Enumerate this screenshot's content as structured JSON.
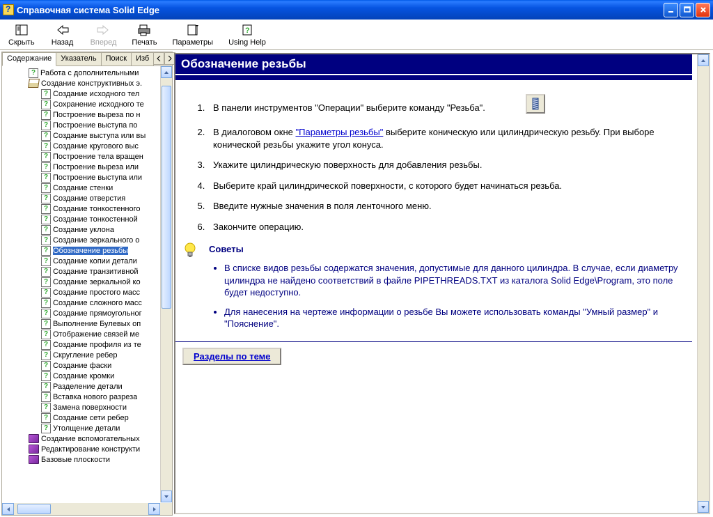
{
  "window": {
    "title": "Справочная система Solid Edge"
  },
  "toolbar": {
    "hide": "Скрыть",
    "back": "Назад",
    "forward": "Вперед",
    "print": "Печать",
    "options": "Параметры",
    "using_help": "Using Help"
  },
  "tabs": {
    "contents": "Содержание",
    "index": "Указатель",
    "search": "Поиск",
    "favorites": "Изб"
  },
  "tree": {
    "root1": "Работа с дополнительными",
    "root2": "Создание конструктивных э.",
    "children2": [
      "Создание исходного тел",
      "Сохранение исходного те",
      "Построение выреза по н",
      "Построение выступа по",
      "Создание выступа или вы",
      "Создание кругового выс",
      "Построение тела вращен",
      "Построение выреза или",
      "Построение выступа или",
      "Создание стенки",
      "Создание отверстия",
      "Создание тонкостенного",
      "Создание тонкостенной",
      "Создание уклона",
      "Создание зеркального о",
      "Обозначение резьбы",
      "Создание копии детали",
      "Создание транзитивной",
      "Создание зеркальной ко",
      "Создание простого масс",
      "Создание сложного масс",
      "Создание прямоугольног",
      "Выполнение Булевых оп",
      "Отображение связей ме",
      "Создание профиля из те",
      "Скругление ребер",
      "Создание фаски",
      "Создание кромки",
      "Разделение детали",
      "Вставка нового разреза",
      "Замена поверхности",
      "Создание сети ребер",
      "Утолщение детали"
    ],
    "root3": "Создание вспомогательных",
    "root4": "Редактирование конструкти",
    "root5": "Базовые плоскости",
    "selected_index": 15
  },
  "content": {
    "title": "Обозначение резьбы",
    "step1": "В панели инструментов \"Операции\" выберите команду \"Резьба\".",
    "step2a": "В диалоговом окне ",
    "step2_link": "\"Параметры резьбы\"",
    "step2b": " выберите коническую или цилиндрическую резьбу. При выборе конической резьбы укажите угол конуса.",
    "step3": "Укажите цилиндрическую поверхность для добавления резьбы.",
    "step4": "Выберите край цилиндрической поверхности, с которого будет начинаться резьба.",
    "step5": "Введите нужные значения в поля ленточного меню.",
    "step6": "Закончите операцию.",
    "tips_title": "Советы",
    "tip1": "В списке видов резьбы содержатся значения, допустимые для данного цилиндра. В случае, если диаметру цилиндра не найдено соответствий в файле PIPETHREADS.TXT из каталога Solid Edge\\Program, это поле будет недоступно.",
    "tip2": "Для нанесения на чертеже информации о резьбе Вы можете использовать команды \"Умный размер\" и \"Пояснение\".",
    "related_button": "Разделы по теме"
  }
}
